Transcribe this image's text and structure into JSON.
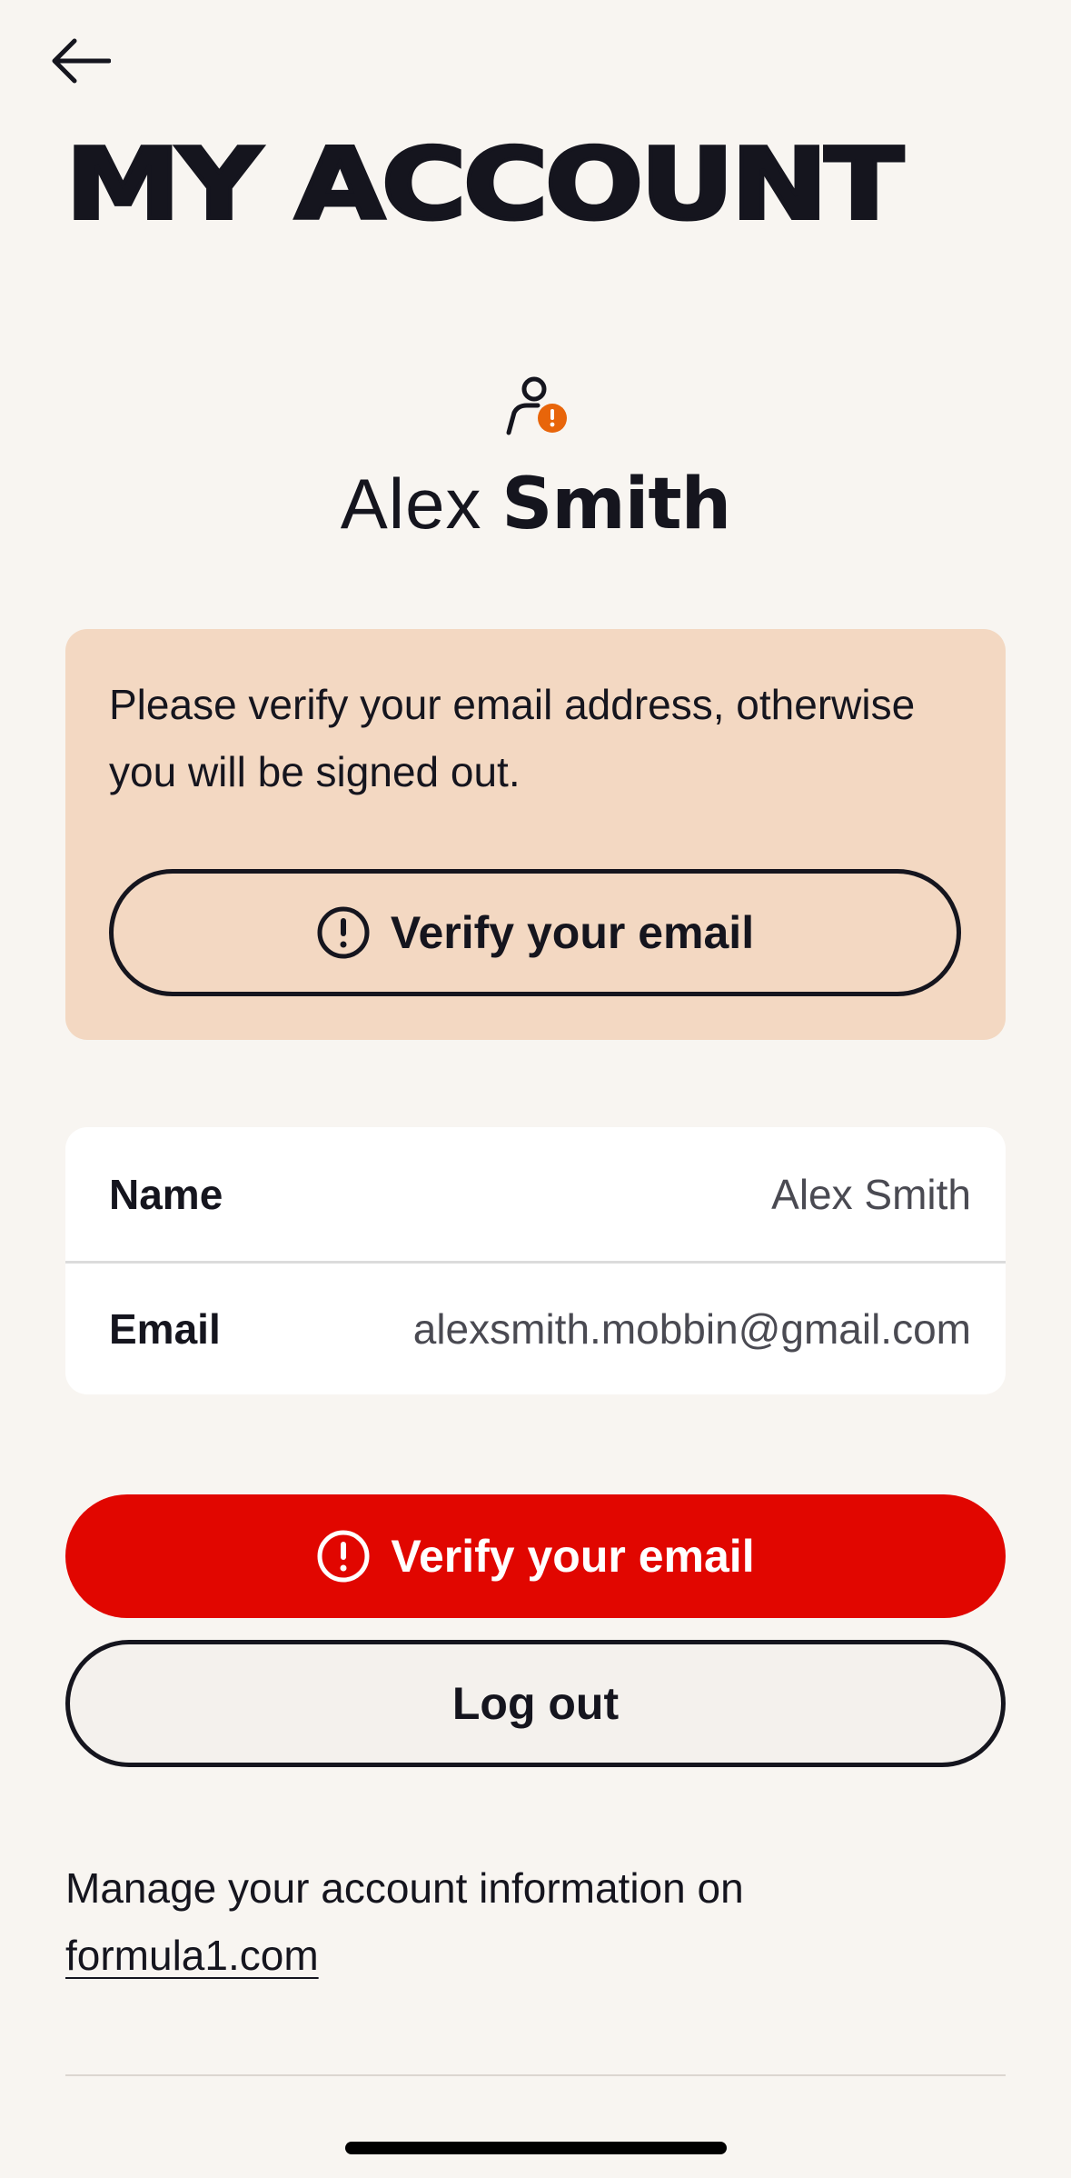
{
  "header": {
    "back_icon": "arrow-left-icon",
    "title": "MY ACCOUNT"
  },
  "profile": {
    "avatar_icon": "user-warning-icon",
    "first_name": "Alex",
    "last_name": "Smith"
  },
  "verify_card": {
    "message": "Please verify your email address, otherwise you will be signed out.",
    "button_icon": "alert-circle-icon",
    "button_label": "Verify your email"
  },
  "account_info": {
    "rows": [
      {
        "label": "Name",
        "value": "Alex Smith"
      },
      {
        "label": "Email",
        "value": "alexsmith.mobbin@gmail.com"
      }
    ]
  },
  "actions": {
    "verify_icon": "alert-circle-icon",
    "verify_label": "Verify your email",
    "logout_label": "Log out"
  },
  "manage": {
    "text": "Manage your account information on ",
    "link": "formula1.com"
  },
  "colors": {
    "background": "#f8f5f1",
    "warning_card": "#f3d8c2",
    "primary_red": "#e10600",
    "badge_orange": "#e8650a",
    "text": "#15151e"
  }
}
